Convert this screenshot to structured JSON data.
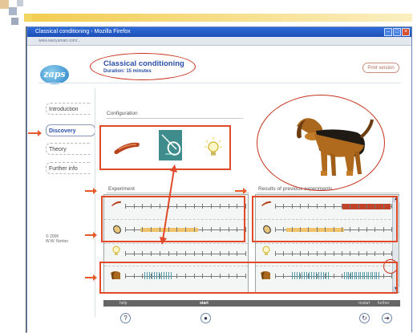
{
  "window": {
    "title": "Classical conditioning - Mozilla Firefox",
    "url": "www.wanyuman.com/..."
  },
  "app": {
    "title": "Classical conditioning",
    "duration": "Duration: 15 minutes",
    "print_label": "Print version",
    "logo": "zaps"
  },
  "nav": [
    {
      "label": "Introduction"
    },
    {
      "label": "Discovery"
    },
    {
      "label": "Theory"
    },
    {
      "label": "Further info"
    }
  ],
  "copyright": [
    "© 2006",
    "W.W. Norton"
  ],
  "configuration": {
    "label": "Configuration",
    "stimuli": [
      "sausage-icon",
      "bell-icon",
      "light-bulb-icon"
    ]
  },
  "experiment": {
    "label": "Experiment"
  },
  "results": {
    "label": "Results of previous experiments"
  },
  "controls": {
    "help": "help",
    "start": "start",
    "restart": "restart",
    "further": "further"
  },
  "colors": {
    "accent": "#2b4fa8",
    "annotation": "#e04a2a",
    "timeline": "#e6a800",
    "saliva": "#4e9aa8"
  }
}
